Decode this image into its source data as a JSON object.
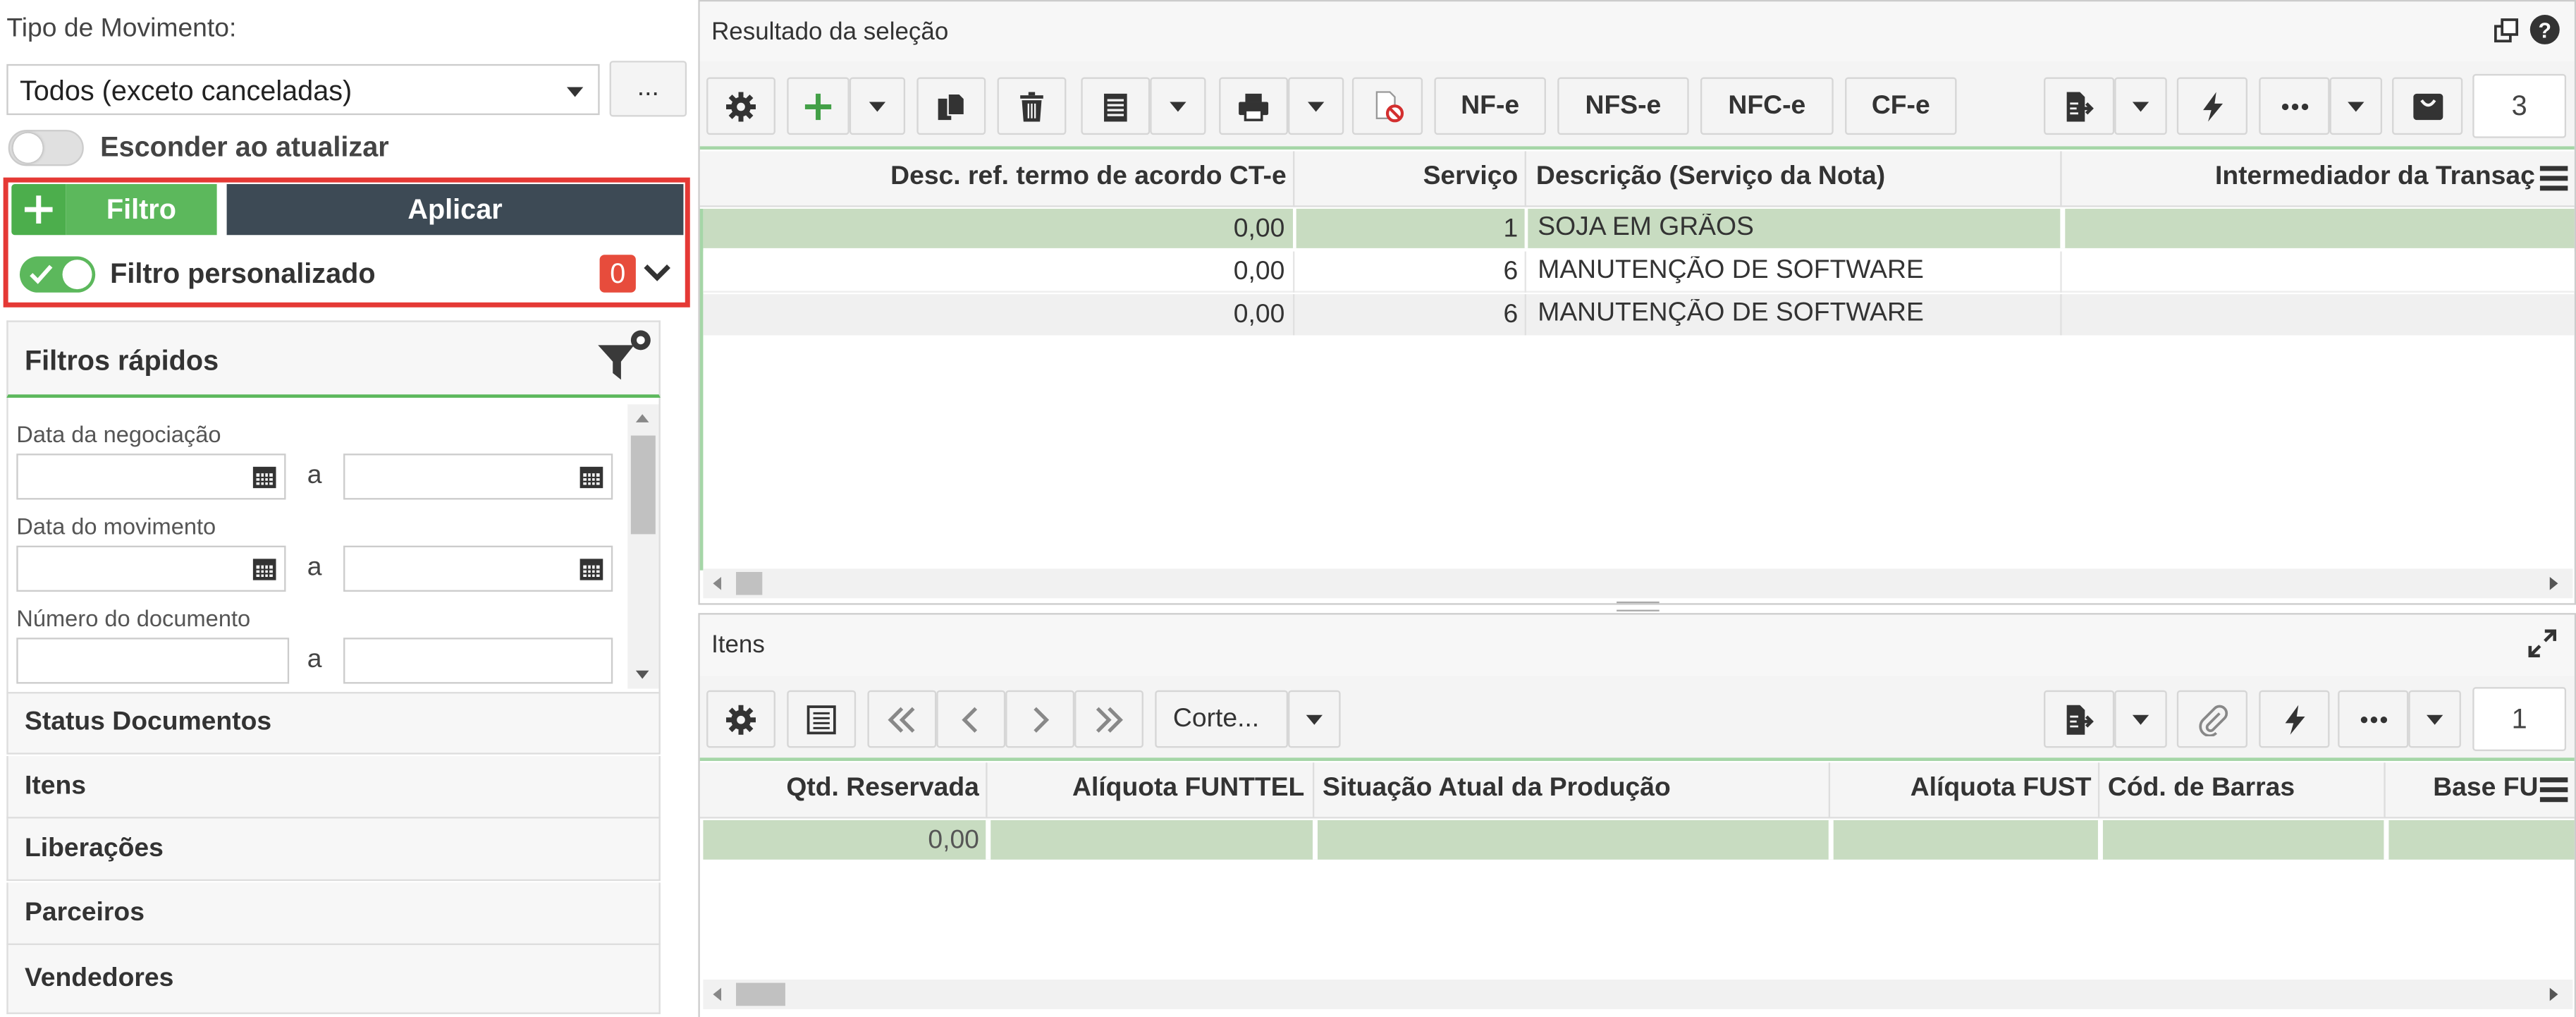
{
  "left": {
    "movement_label": "Tipo de Movimento:",
    "movement_value": "Todos (exceto canceladas)",
    "more_label": "...",
    "hide_on_update_label": "Esconder ao atualizar",
    "filter_label": "Filtro",
    "apply_label": "Aplicar",
    "custom_filter_label": "Filtro personalizado",
    "custom_filter_count": "0",
    "quick_filters_title": "Filtros rápidos",
    "range_sep": "a",
    "fields": [
      {
        "label": "Data da negociação"
      },
      {
        "label": "Data do movimento"
      },
      {
        "label": "Número do documento"
      }
    ],
    "sections": [
      "Status Documentos",
      "Itens",
      "Liberações",
      "Parceiros",
      "Vendedores"
    ]
  },
  "results": {
    "title": "Resultado da seleção",
    "toolbar": {
      "nfe": "NF-e",
      "nfse": "NFS-e",
      "nfce": "NFC-e",
      "cfe": "CF-e",
      "page": "3"
    },
    "columns": [
      "Desc. ref. termo de acordo CT-e",
      "Serviço",
      "Descrição (Serviço da Nota)",
      "Intermediador da Transaç"
    ],
    "rows": [
      [
        "0,00",
        "1",
        "SOJA EM GRÃOS",
        ""
      ],
      [
        "0,00",
        "6",
        "MANUTENÇÃO DE SOFTWARE",
        ""
      ],
      [
        "0,00",
        "6",
        "MANUTENÇÃO DE SOFTWARE",
        ""
      ]
    ]
  },
  "items": {
    "title": "Itens",
    "cut_label": "Corte...",
    "page": "1",
    "columns": [
      "Qtd. Reservada",
      "Alíquota FUNTTEL",
      "Situação Atual da Produção",
      "Alíquota FUST",
      "Cód. de Barras",
      "Base FU"
    ],
    "rows": [
      [
        "0,00",
        "",
        "",
        "",
        "",
        ""
      ]
    ]
  },
  "colors": {
    "accent_green": "#5cb85c",
    "apply_dark": "#3d4a55",
    "highlight": "#e53935",
    "badge": "#e74c3c",
    "row_selected": "#c8dcc1"
  }
}
